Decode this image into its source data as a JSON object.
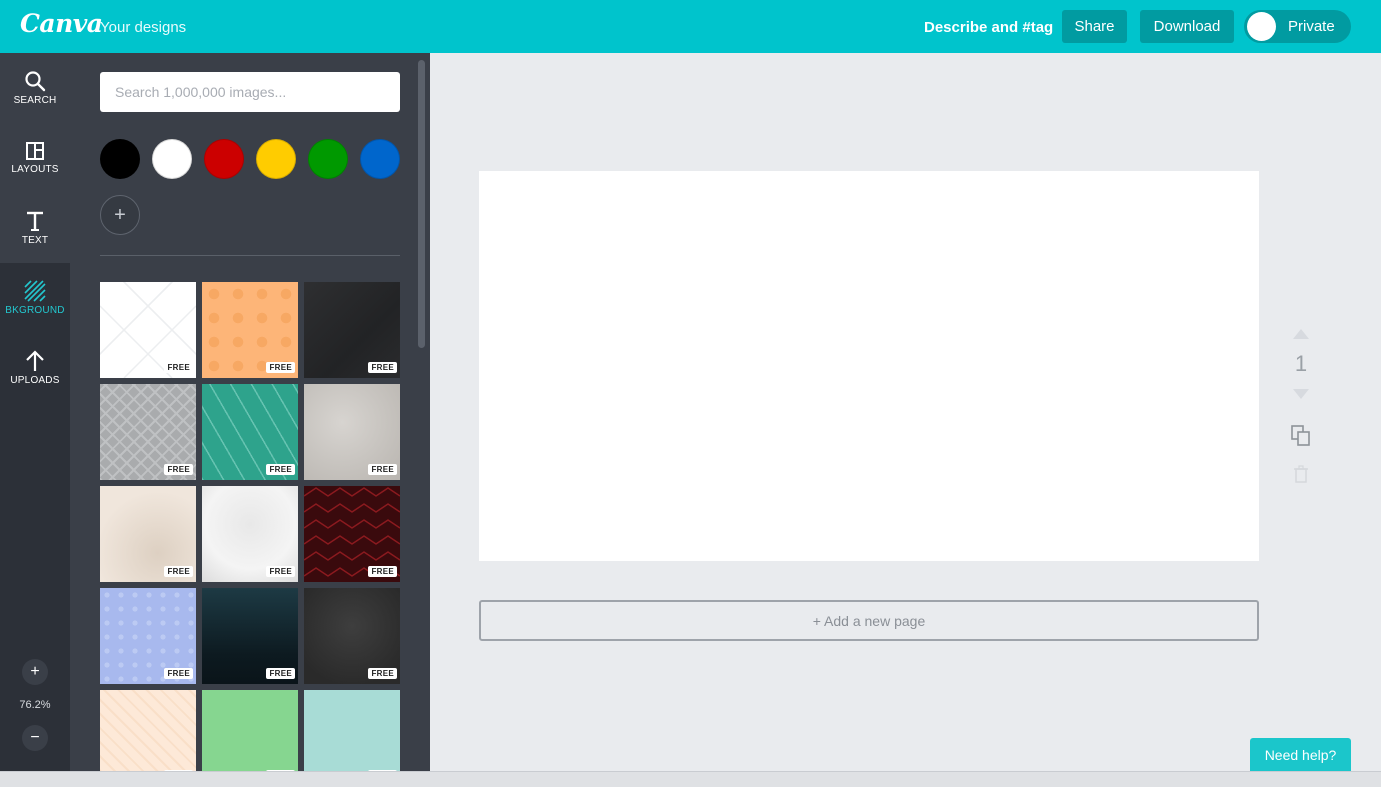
{
  "topbar": {
    "logo": "Canva",
    "your_designs": "Your designs",
    "describe": "Describe and #tag",
    "share_label": "Share",
    "download_label": "Download",
    "privacy_label": "Private"
  },
  "rail": {
    "items": [
      {
        "label": "SEARCH",
        "icon": "search-icon"
      },
      {
        "label": "LAYOUTS",
        "icon": "layouts-icon"
      },
      {
        "label": "TEXT",
        "icon": "text-icon"
      },
      {
        "label": "BKGROUND",
        "icon": "background-icon",
        "active": true
      },
      {
        "label": "UPLOADS",
        "icon": "upload-icon"
      }
    ],
    "zoom_in": "+",
    "zoom_value": "76.2%",
    "zoom_out": "−"
  },
  "panel": {
    "search_placeholder": "Search 1,000,000 images...",
    "swatch_colors": [
      "#000000",
      "#ffffff",
      "#cc0000",
      "#ffcc00",
      "#009900",
      "#0066cc"
    ],
    "add_color": "+",
    "free_label": "FREE",
    "tiles": [
      {
        "name": "white-lattice"
      },
      {
        "name": "peach-circles"
      },
      {
        "name": "dark-charcoal"
      },
      {
        "name": "grey-crosshatch"
      },
      {
        "name": "teal-stripes"
      },
      {
        "name": "grey-concrete"
      },
      {
        "name": "beige-paper"
      },
      {
        "name": "white-marble"
      },
      {
        "name": "red-chevron"
      },
      {
        "name": "periwinkle-dots"
      },
      {
        "name": "dark-teal-gradient"
      },
      {
        "name": "dark-grey-texture"
      },
      {
        "name": "cream-herringbone"
      },
      {
        "name": "mint-green"
      },
      {
        "name": "aqua-solid"
      }
    ]
  },
  "canvas": {
    "add_page_label": "+ Add a new page",
    "page_number": "1"
  },
  "help_label": "Need help?"
}
